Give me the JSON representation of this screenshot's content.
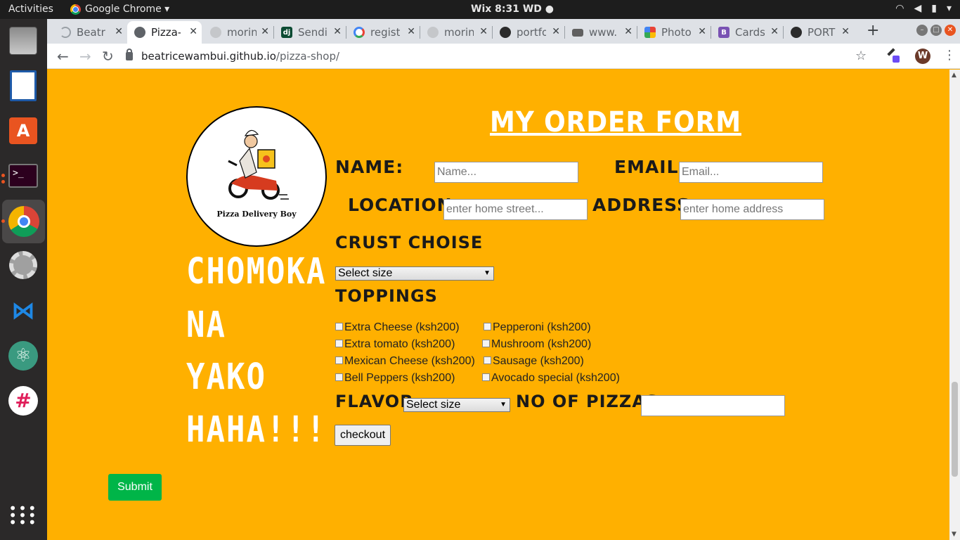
{
  "topbar": {
    "activities": "Activities",
    "app_name": "Google Chrome ▾",
    "clock": "Wix  8:31 WD ●"
  },
  "tabs": [
    {
      "label": "Beatri",
      "icon": "loading-icon",
      "color": "#5f6368"
    },
    {
      "label": "Pizza-",
      "icon": "globe-icon",
      "color": "#5f6368"
    },
    {
      "label": "morin",
      "icon": "github-icon",
      "color": "#9aa0a6"
    },
    {
      "label": "Sendi",
      "icon": "django-icon",
      "color": "#0c4b33"
    },
    {
      "label": "regist",
      "icon": "google-icon",
      "color": "#4285f4"
    },
    {
      "label": "morin",
      "icon": "github-icon",
      "color": "#9aa0a6"
    },
    {
      "label": "portfo",
      "icon": "github-icon",
      "color": "#2b2b2b"
    },
    {
      "label": "www.",
      "icon": "youtube-icon",
      "color": "#606060"
    },
    {
      "label": "Photo",
      "icon": "photos-icon",
      "color": "#ea4335"
    },
    {
      "label": "Cards",
      "icon": "bootstrap-icon",
      "color": "#7952b3"
    },
    {
      "label": "PORT",
      "icon": "github-icon",
      "color": "#2b2b2b"
    }
  ],
  "address_bar": {
    "host": "beatricewambui.github.io",
    "path": "/pizza-shop/"
  },
  "profile_initial": "W",
  "page": {
    "logo_caption": "Pizza Delivery Boy",
    "slogan": [
      "CHOMOKA",
      "NA",
      "YAKO",
      "HAHA!!!"
    ],
    "title": "MY ORDER FORM",
    "labels": {
      "name": "NAME:",
      "email": "EMAIL:",
      "location": "LOCATION:",
      "address": "ADDRESS:",
      "crust": "CRUST CHOISE",
      "toppings": "TOPPINGS",
      "flavor": "FLAVOR",
      "count": "NO OF PIZZAS"
    },
    "placeholders": {
      "name": "Name...",
      "email": "Email...",
      "location": "enter home street...",
      "address": "enter home address"
    },
    "crust_select": "Select size",
    "flavor_select": "Select size",
    "toppings_left": [
      " Extra Cheese (ksh200)",
      "Extra tomato (ksh200)",
      "Mexican Cheese (ksh200)",
      "Bell Peppers (ksh200)"
    ],
    "toppings_right": [
      "Pepperoni (ksh200)",
      "Mushroom (ksh200)",
      "Sausage (ksh200)",
      "Avocado special (ksh200)"
    ],
    "checkout": "checkout",
    "submit": "Submit"
  }
}
